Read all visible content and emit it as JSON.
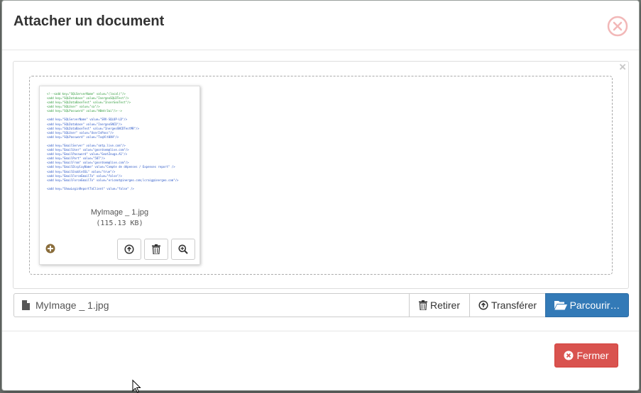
{
  "modal": {
    "title": "Attacher un document",
    "close_icon": "circle-x-icon"
  },
  "preview": {
    "file_name": "MyImage _ 1.jpg",
    "file_size": "(115.13 KB)",
    "code_lines": [
      {
        "text": "<!--<add key=\"SQLServerName\" value=\"(local)\"/>",
        "color": "green"
      },
      {
        "text": "<add key=\"SQLDatabase\" value=\"InergeoSQLDTest\"/>",
        "color": "green"
      },
      {
        "text": "<add key=\"SQLDataBaseTest\" value=\"InserGeoTest\"/>",
        "color": "green"
      },
      {
        "text": "<add key=\"SQLUser\" value=\"sa\"/>",
        "color": "green"
      },
      {
        "text": "<add key=\"SQLPassword\" value=\"H0mtr3ai\"/>-->",
        "color": "green"
      },
      {
        "text": "",
        "color": "gap"
      },
      {
        "text": "<add key=\"SQLServerName\" value=\"SRV-SQLUP-LD\"/>",
        "color": "blue"
      },
      {
        "text": "<add key=\"SQLDatabase\" value=\"InergeoSNCD\"/>",
        "color": "blue"
      },
      {
        "text": "<add key=\"SQLDataBaseTest\" value=\"InergeoSNCDTestMR\"/>",
        "color": "blue"
      },
      {
        "text": "<add key=\"SQLUser\" value=\"UserInPass\"/>",
        "color": "blue"
      },
      {
        "text": "<add key=\"SQLPassword\" value=\"TxqAlt0XH\"/>",
        "color": "blue"
      },
      {
        "text": "",
        "color": "gap"
      },
      {
        "text": "<add key=\"EmailServer\" value=\"smtp.live.com\"/>",
        "color": "blue"
      },
      {
        "text": "<add key=\"EmailUser\" value=\"goordsem@live.com\"/>",
        "color": "blue"
      },
      {
        "text": "<add key=\"EmailPassword\" value=\"GeatZouga.A1\"/>",
        "color": "blue"
      },
      {
        "text": "<add key=\"EmailPort\" value=\"587\"/>",
        "color": "blue"
      },
      {
        "text": "<add key=\"EmailFrom\" value=\"goordsem@live.com\"/>",
        "color": "blue"
      },
      {
        "text": "<add key=\"EmailDisplayName\" value=\"Compte de dépenses / Expenses report\" />",
        "color": "blue"
      },
      {
        "text": "<add key=\"EmailEnableSSL\" value=\"true\"/>",
        "color": "blue"
      },
      {
        "text": "<add key=\"EmailForceEmailTo\" value=\"false\"/>",
        "color": "blue"
      },
      {
        "text": "<add key=\"EmailForceEmailTo\" value=\"ericmot@inergeo.com;lcraig@inergeo.com\"/>",
        "color": "blue"
      },
      {
        "text": "",
        "color": "gap"
      },
      {
        "text": "<add key=\"ShowLoginReportToClient\" value=\"false\" />",
        "color": "blue"
      }
    ]
  },
  "input_row": {
    "caption": "MyImage _ 1.jpg",
    "remove_label": "Retirer",
    "upload_label": "Transférer",
    "browse_label": "Parcourir…"
  },
  "footer": {
    "close_label": "Fermer"
  },
  "colors": {
    "primary": "#337ab7",
    "danger": "#d9534f",
    "close_icon": "#f2b8b8",
    "plus_badge": "#8a6d3b"
  }
}
